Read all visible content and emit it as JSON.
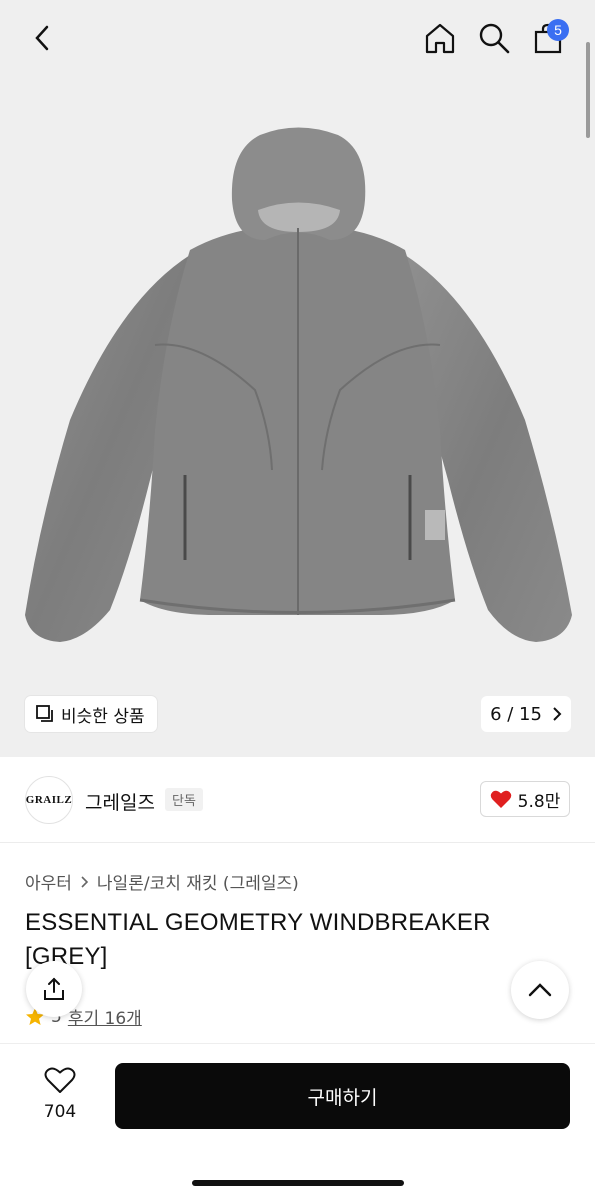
{
  "header": {
    "icons": [
      "back-icon",
      "home-icon",
      "search-icon",
      "bag-icon"
    ],
    "cart_count": "5"
  },
  "gallery": {
    "similar_label": "비슷한 상품",
    "pager": "6 / 15"
  },
  "brand": {
    "logo_text": "GRAILZ",
    "name": "그레일즈",
    "tag": "단독",
    "likes": "5.8만"
  },
  "product": {
    "breadcrumb": [
      "아우터",
      "나일론/코치 재킷 (그레일즈)"
    ],
    "title": "ESSENTIAL GEOMETRY WINDBREAKER [GREY]",
    "rating": "5",
    "reviews": "후기 16개"
  },
  "bottom": {
    "wish_count": "704",
    "buy_label": "구매하기"
  },
  "colors": {
    "accent_badge": "#3a6ff2",
    "heart": "#e02020",
    "star": "#f6b400",
    "buy_button": "#0a0a0a"
  }
}
